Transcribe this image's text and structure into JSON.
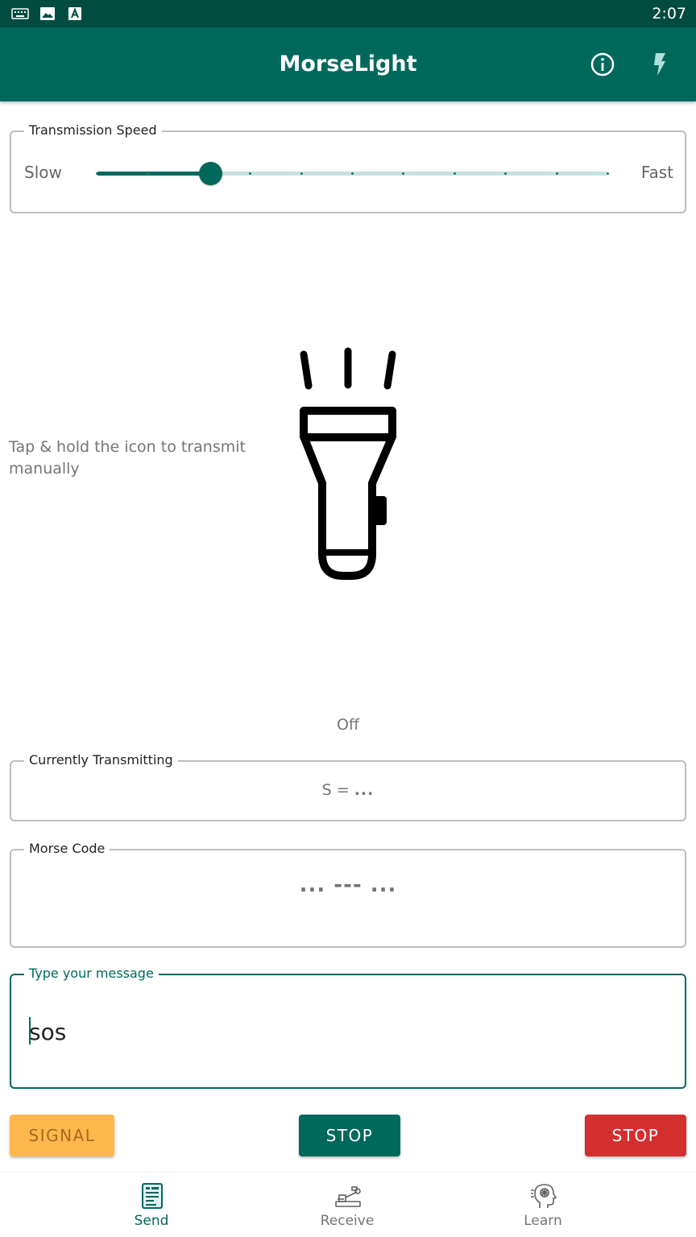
{
  "status_bar": {
    "time": "2:07",
    "icons": [
      "keyboard-icon",
      "image-icon",
      "text-a-icon"
    ]
  },
  "app_bar": {
    "title": "MorseLight",
    "actions": [
      "info-icon",
      "flash-icon"
    ]
  },
  "speed": {
    "legend": "Transmission Speed",
    "slow_label": "Slow",
    "fast_label": "Fast",
    "steps": 10,
    "value_fraction": 0.222
  },
  "manual": {
    "hint": "Tap & hold the icon to transmit manually",
    "flashlight_icon": "flashlight-icon",
    "status": "Off"
  },
  "current": {
    "legend": "Currently Transmitting",
    "prefix": "S = ",
    "symbol": "..."
  },
  "morse": {
    "legend": "Morse Code",
    "value": "... --- ..."
  },
  "message": {
    "legend": "Type your message",
    "value": "sos"
  },
  "buttons": {
    "signal": "SIGNAL",
    "stop_main": "STOP",
    "stop_red": "STOP"
  },
  "nav": {
    "items": [
      {
        "label": "Send",
        "icon": "send-icon",
        "active": true
      },
      {
        "label": "Receive",
        "icon": "telegraph-key-icon",
        "active": false
      },
      {
        "label": "Learn",
        "icon": "brain-head-icon",
        "active": false
      }
    ]
  },
  "colors": {
    "primary": "#00695c",
    "primary_dark": "#004d40",
    "signal": "#ffb74d",
    "stop_red": "#d32f2f"
  }
}
